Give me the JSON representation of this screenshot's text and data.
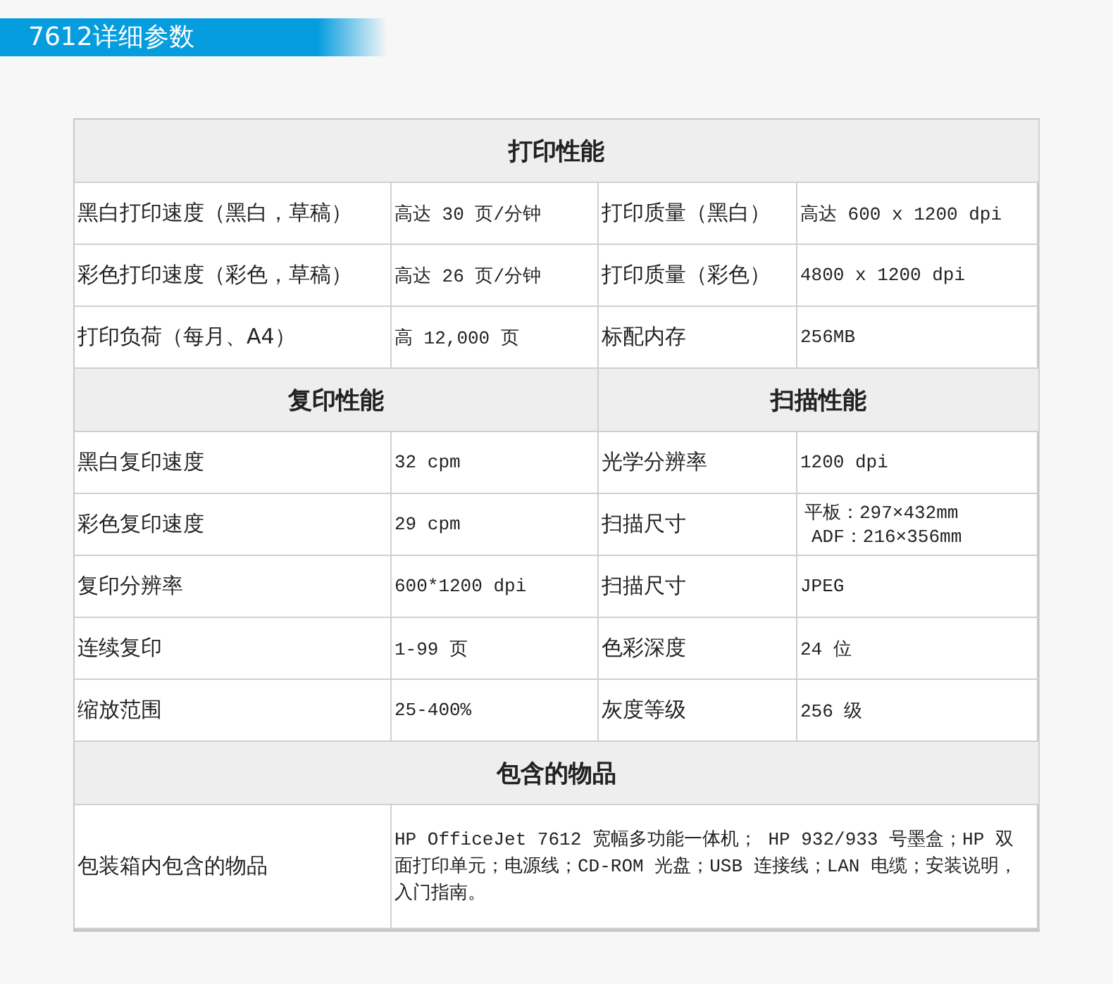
{
  "title": "7612详细参数",
  "rows": [
    {
      "kind": "heading",
      "cells": [
        "打印性能"
      ]
    },
    {
      "kind": "spec",
      "cells": [
        "黑白打印速度（黑白，草稿）",
        "高达 30 页/分钟",
        "打印质量（黑白）",
        "高达 600 x 1200 dpi"
      ]
    },
    {
      "kind": "spec",
      "cells": [
        "彩色打印速度（彩色，草稿）",
        "高达 26 页/分钟",
        "打印质量（彩色）",
        "4800 x 1200 dpi"
      ]
    },
    {
      "kind": "spec",
      "cells": [
        "打印负荷（每月、A4）",
        "高 12,000 页",
        "标配内存",
        "256MB"
      ]
    },
    {
      "kind": "heading",
      "cells": [
        "复印性能",
        "扫描性能"
      ]
    },
    {
      "kind": "spec",
      "cells": [
        "黑白复印速度",
        "32 cpm",
        "光学分辨率",
        "1200 dpi"
      ]
    },
    {
      "kind": "spec",
      "cells": [
        "彩色复印速度",
        "29 cpm",
        "扫描尺寸",
        [
          "平板：297×432mm",
          "ADF：216×356mm"
        ]
      ]
    },
    {
      "kind": "spec",
      "cells": [
        "复印分辨率",
        "600*1200 dpi",
        "扫描尺寸",
        "JPEG"
      ]
    },
    {
      "kind": "spec",
      "cells": [
        "连续复印",
        "1-99 页",
        "色彩深度",
        "24 位"
      ]
    },
    {
      "kind": "spec",
      "cells": [
        "缩放范围",
        "25-400%",
        "灰度等级",
        "256 级"
      ]
    },
    {
      "kind": "heading",
      "cells": [
        "包含的物品"
      ]
    },
    {
      "kind": "wide",
      "cells": [
        "包装箱内包含的物品",
        "HP OfficeJet 7612 宽幅多功能一体机； HP 932/933 号墨盒；HP 双面打印单元；电源线；CD-ROM 光盘；USB 连接线；LAN 电缆；安装说明，入门指南。"
      ]
    }
  ]
}
